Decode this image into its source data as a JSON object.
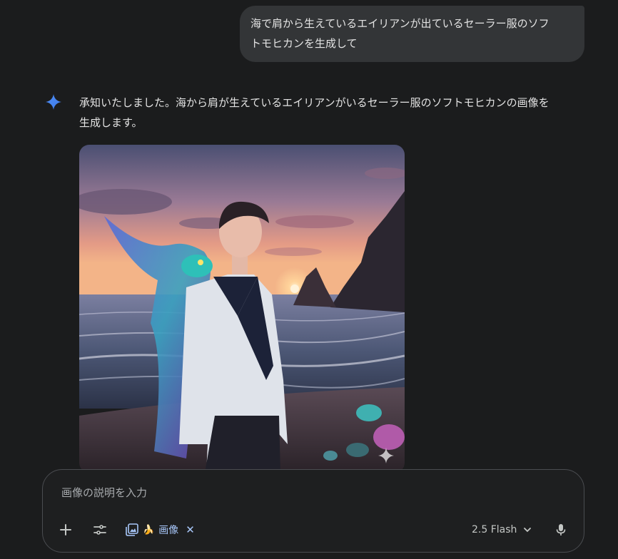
{
  "user_message": {
    "line1": "海で肩から生えているエイリアンが出ているセーラー服のソフ",
    "line2": "トモヒカンを生成して"
  },
  "assistant": {
    "line1": "承知いたしました。海から肩が生えているエイリアンがいるセーラー服のソフトモヒカンの画像を",
    "line2": "生成します。"
  },
  "composer": {
    "placeholder": "画像の説明を入力",
    "chip_label": "画像",
    "chip_emoji": "🍌",
    "chip_close": "✕",
    "model_label": "2.5 Flash"
  },
  "icons": {
    "assistant": "gemini-sparkle-icon",
    "add": "plus-icon",
    "tools": "tune-icon",
    "image_tool": "image-gallery-icon",
    "model_dropdown": "chevron-down-icon",
    "mic": "microphone-icon",
    "image_badge": "sparkle-watermark-icon"
  },
  "colors": {
    "background": "#1b1c1d",
    "bubble": "#333537",
    "accent": "#a8c7fa",
    "gemini_blue": "#4285f4"
  }
}
